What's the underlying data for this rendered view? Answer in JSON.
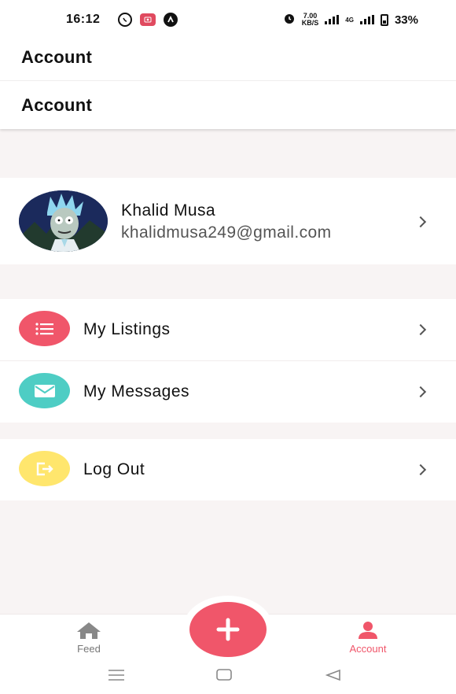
{
  "status_bar": {
    "time": "16:12",
    "speed_value": "7.00",
    "speed_unit": "KB/S",
    "network": "4G",
    "battery": "33%"
  },
  "header": {
    "app_title": "Account",
    "screen_title": "Account"
  },
  "profile": {
    "name": "Khalid Musa",
    "email": "khalidmusa249@gmail.com"
  },
  "menu": {
    "items": [
      {
        "label": "My Listings",
        "icon": "list-icon",
        "color": "#f0566a"
      },
      {
        "label": "My Messages",
        "icon": "mail-icon",
        "color": "#4ecdc4"
      },
      {
        "label": "Log Out",
        "icon": "logout-icon",
        "color": "#ffe66d"
      }
    ]
  },
  "bottom_nav": {
    "feed_label": "Feed",
    "account_label": "Account",
    "add_icon": "plus-icon"
  },
  "colors": {
    "primary": "#f0566a",
    "secondary": "#4ecdc4",
    "warning": "#ffe66d",
    "background": "#f8f4f4"
  }
}
